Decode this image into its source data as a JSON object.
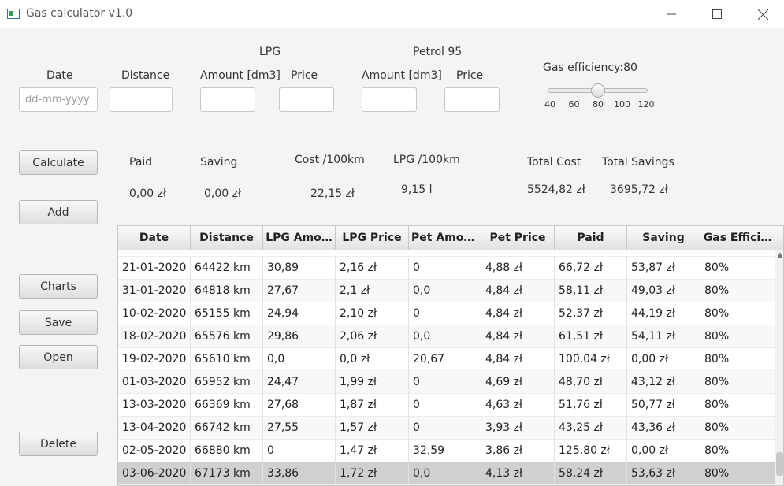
{
  "window": {
    "title": "Gas calculator v1.0"
  },
  "inputs": {
    "date_label": "Date",
    "date_placeholder": "dd-mm-yyyy",
    "distance_label": "Distance",
    "lpg_group": "LPG",
    "lpg_amount_label": "Amount [dm3]",
    "lpg_price_label": "Price",
    "petrol_group": "Petrol 95",
    "petrol_amount_label": "Amount [dm3]",
    "petrol_price_label": "Price"
  },
  "efficiency": {
    "label": "Gas efficiency:80",
    "value": 80,
    "min": 40,
    "max": 120,
    "ticks": [
      "40",
      "60",
      "80",
      "100",
      "120"
    ]
  },
  "buttons": {
    "calculate": "Calculate",
    "add": "Add",
    "charts": "Charts",
    "save": "Save",
    "open": "Open",
    "delete": "Delete"
  },
  "summary": {
    "paid_label": "Paid",
    "paid_value": "0,00 zł",
    "saving_label": "Saving",
    "saving_value": "0,00 zł",
    "cost_label": "Cost /100km",
    "cost_value": "22,15 zł",
    "lpg100_label": "LPG /100km",
    "lpg100_value": "9,15 l",
    "total_cost_label": "Total Cost",
    "total_cost_value": "5524,82 zł",
    "total_savings_label": "Total Savings",
    "total_savings_value": "3695,72 zł"
  },
  "table": {
    "columns": [
      "Date",
      "Distance",
      "LPG Amo…",
      "LPG Price",
      "Pet Amount",
      "Pet Price",
      "Paid",
      "Saving",
      "Gas Effici…"
    ],
    "rows": [
      [
        "21-01-2020",
        "64422 km",
        "30,89",
        "2,16 zł",
        "0",
        "4,88 zł",
        "66,72 zł",
        "53,87 zł",
        "80%"
      ],
      [
        "31-01-2020",
        "64818 km",
        "27,67",
        "2,1 zł",
        "0,0",
        "4,84 zł",
        "58,11 zł",
        "49,03 zł",
        "80%"
      ],
      [
        "10-02-2020",
        "65155 km",
        "24,94",
        "2,10 zł",
        "0",
        "4,84 zł",
        "52,37 zł",
        "44,19 zł",
        "80%"
      ],
      [
        "18-02-2020",
        "65576 km",
        "29,86",
        "2,06 zł",
        "0,0",
        "4,84 zł",
        "61,51 zł",
        "54,11 zł",
        "80%"
      ],
      [
        "19-02-2020",
        "65610 km",
        "0,0",
        "0,0 zł",
        "20,67",
        "4,84 zł",
        "100,04 zł",
        "0,00 zł",
        "80%"
      ],
      [
        "01-03-2020",
        "65952 km",
        "24,47",
        "1,99 zł",
        "0",
        "4,69 zł",
        "48,70 zł",
        "43,12 zł",
        "80%"
      ],
      [
        "13-03-2020",
        "66369 km",
        "27,68",
        "1,87 zł",
        "0",
        "4,63 zł",
        "51,76 zł",
        "50,77 zł",
        "80%"
      ],
      [
        "13-04-2020",
        "66742 km",
        "27,55",
        "1,57 zł",
        "0",
        "3,93 zł",
        "43,25 zł",
        "43,36 zł",
        "80%"
      ],
      [
        "02-05-2020",
        "66880 km",
        "0",
        "1,47 zł",
        "32,59",
        "3,86 zł",
        "125,80 zł",
        "0,00 zł",
        "80%"
      ],
      [
        "03-06-2020",
        "67173 km",
        "33,86",
        "1,72 zł",
        "0,0",
        "4,13 zł",
        "58,24 zł",
        "53,63 zł",
        "80%"
      ]
    ],
    "selected_row": 9
  }
}
